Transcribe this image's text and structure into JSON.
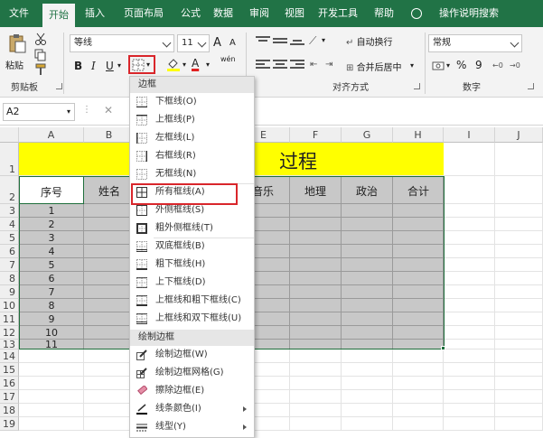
{
  "tabs": [
    "文件",
    "开始",
    "插入",
    "页面布局",
    "公式",
    "数据",
    "审阅",
    "视图",
    "开发工具",
    "帮助",
    "操作说明搜索"
  ],
  "active_tab": "开始",
  "ribbon": {
    "paste_label": "粘贴",
    "clipboard_label": "剪贴板",
    "font_name": "等线",
    "font_size": "11",
    "grow_font": "A",
    "shrink_font": "A",
    "bold": "B",
    "italic": "I",
    "underline": "U",
    "font_color_letter": "A",
    "wen_label": "wén",
    "wrap_text": "自动换行",
    "merge_center": "合并后居中",
    "alignment_label": "对齐方式",
    "number_format": "常规",
    "percent": "%",
    "comma": "9",
    "number_label": "数字",
    "accent_color": "#217346",
    "highlight_color": "#d9262b"
  },
  "formula_bar": {
    "name_box": "A2",
    "cancel": "✕"
  },
  "columns": [
    "A",
    "B",
    "C",
    "D",
    "E",
    "F",
    "G",
    "H",
    "I",
    "J"
  ],
  "rows": [
    "1",
    "2",
    "3",
    "4",
    "5",
    "6",
    "7",
    "8",
    "9",
    "10",
    "11",
    "12",
    "13",
    "14",
    "15",
    "16",
    "17",
    "18",
    "19"
  ],
  "sheet": {
    "title_visible": "过程",
    "headers": [
      "序号",
      "姓名",
      "音乐",
      "地理",
      "政治",
      "合计"
    ],
    "serials": [
      "1",
      "2",
      "3",
      "4",
      "5",
      "6",
      "7",
      "8",
      "9",
      "10",
      "11"
    ],
    "yellow": "#ffff00"
  },
  "menu": {
    "section1": "边框",
    "items1": [
      {
        "label": "下框线(O)",
        "icon": "border-bottom-icon"
      },
      {
        "label": "上框线(P)",
        "icon": "border-top-icon"
      },
      {
        "label": "左框线(L)",
        "icon": "border-left-icon"
      },
      {
        "label": "右框线(R)",
        "icon": "border-right-icon"
      },
      {
        "label": "无框线(N)",
        "icon": "border-none-icon"
      },
      {
        "label": "所有框线(A)",
        "icon": "border-all-icon"
      },
      {
        "label": "外侧框线(S)",
        "icon": "border-outside-icon"
      },
      {
        "label": "粗外侧框线(T)",
        "icon": "border-thick-outside-icon"
      },
      {
        "label": "双底框线(B)",
        "icon": "border-double-bottom-icon"
      },
      {
        "label": "粗下框线(H)",
        "icon": "border-thick-bottom-icon"
      },
      {
        "label": "上下框线(D)",
        "icon": "border-top-bottom-icon"
      },
      {
        "label": "上框线和粗下框线(C)",
        "icon": "border-top-thick-bottom-icon"
      },
      {
        "label": "上框线和双下框线(U)",
        "icon": "border-top-double-bottom-icon"
      }
    ],
    "section2": "绘制边框",
    "items2": [
      {
        "label": "绘制边框(W)",
        "icon": "draw-border-icon"
      },
      {
        "label": "绘制边框网格(G)",
        "icon": "draw-border-grid-icon"
      },
      {
        "label": "擦除边框(E)",
        "icon": "eraser-icon"
      },
      {
        "label": "线条颜色(I)",
        "icon": "line-color-icon"
      },
      {
        "label": "线型(Y)",
        "icon": "line-style-icon"
      }
    ]
  }
}
